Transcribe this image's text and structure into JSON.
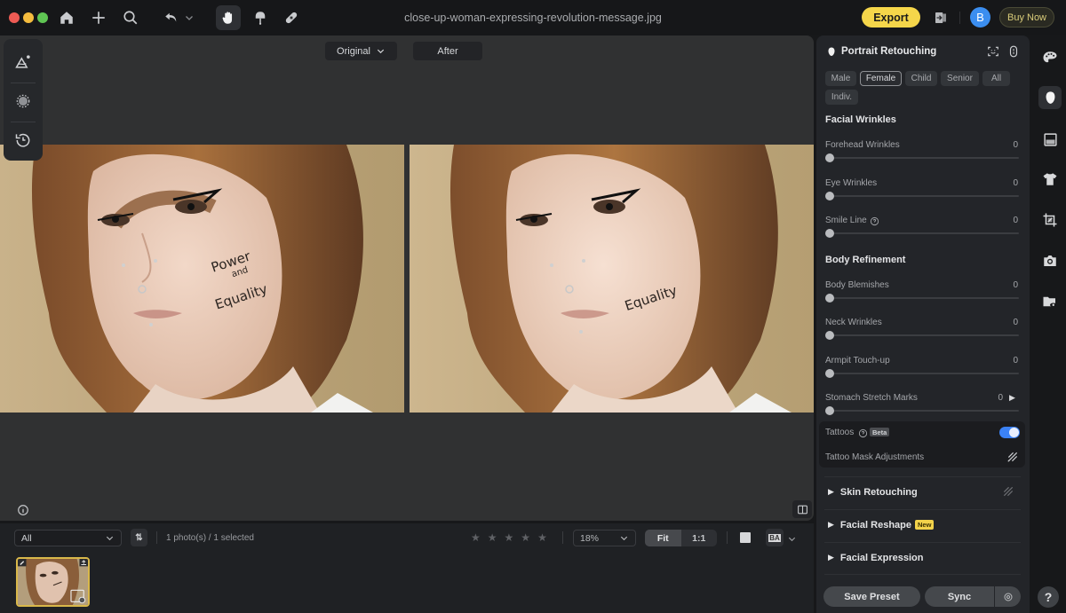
{
  "window": {
    "filename": "close-up-woman-expressing-revolution-message.jpg"
  },
  "toolbar": {
    "icons": [
      "home-icon",
      "add-icon",
      "search-icon",
      "undo-icon",
      "hand-icon",
      "brush-icon",
      "bandage-icon"
    ],
    "export_label": "Export",
    "avatar_initial": "B",
    "buy_label": "Buy Now"
  },
  "view": {
    "original_label": "Original",
    "after_label": "After",
    "before_text": [
      "Power",
      "and",
      "Equality"
    ],
    "after_text": "Equality"
  },
  "filmstrip": {
    "filter_value": "All",
    "sort_label": "⇅",
    "count_text": "1 photo(s) / 1 selected",
    "rating": 0,
    "rating_max": 5,
    "zoom_value": "18%",
    "fit_label": "Fit",
    "one_to_one_label": "1:1",
    "ba_label": "BA"
  },
  "panel": {
    "title": "Portrait Retouching",
    "chips": [
      {
        "label": "Male",
        "selected": false
      },
      {
        "label": "Female",
        "selected": true
      },
      {
        "label": "Child",
        "selected": false
      },
      {
        "label": "Senior",
        "selected": false
      },
      {
        "label": "All",
        "selected": false
      },
      {
        "label": "Indiv.",
        "selected": false
      }
    ],
    "facial_wrinkles": {
      "title": "Facial Wrinkles",
      "sliders": [
        {
          "label": "Forehead Wrinkles",
          "value": "0"
        },
        {
          "label": "Eye Wrinkles",
          "value": "0"
        },
        {
          "label": "Smile Line",
          "value": "0"
        }
      ]
    },
    "body_refinement": {
      "title": "Body Refinement",
      "sliders": [
        {
          "label": "Body Blemishes",
          "value": "0"
        },
        {
          "label": "Neck Wrinkles",
          "value": "0"
        },
        {
          "label": "Armpit Touch-up",
          "value": "0"
        },
        {
          "label": "Stomach Stretch Marks",
          "value": "0"
        }
      ]
    },
    "tattoos": {
      "label": "Tattoos",
      "badge": "Beta",
      "enabled": true,
      "mask_label": "Tattoo Mask Adjustments"
    },
    "sections": [
      {
        "label": "Skin Retouching",
        "badge": ""
      },
      {
        "label": "Facial Reshape",
        "badge": "New"
      },
      {
        "label": "Facial Expression",
        "badge": ""
      }
    ],
    "save_preset_label": "Save Preset",
    "sync_label": "Sync"
  },
  "rail": {
    "icons": [
      "palette-icon",
      "portrait-icon",
      "filter-icon",
      "clothing-icon",
      "crop-icon",
      "camera-icon",
      "folder-preview-icon"
    ],
    "help_label": "?"
  },
  "colors": {
    "accent": "#f5d64a",
    "toggle": "#3b82f6",
    "avatar": "#3b8ef0"
  }
}
